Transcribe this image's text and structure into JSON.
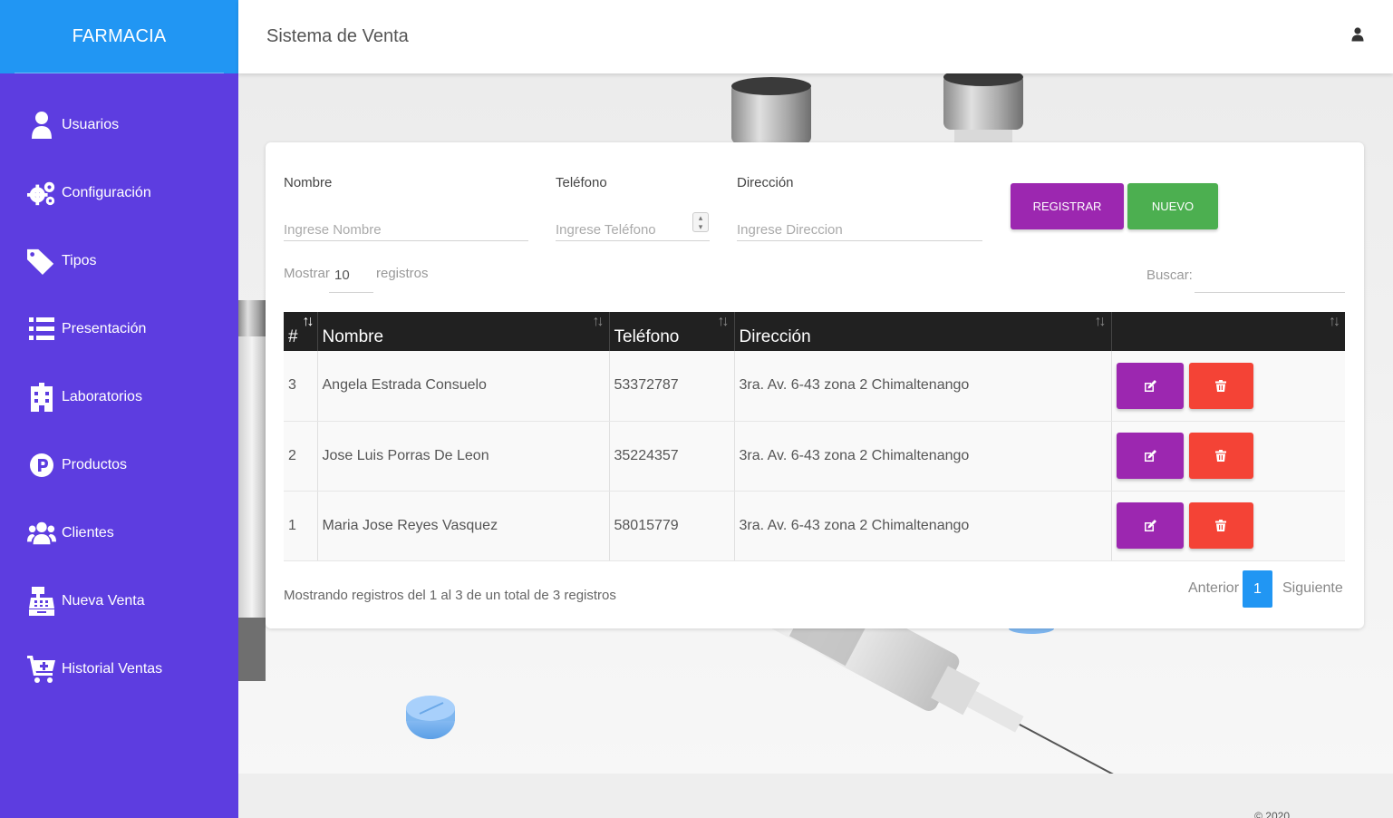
{
  "sidebar": {
    "brand": "FARMACIA",
    "items": [
      {
        "label": "Usuarios",
        "icon": "user-icon"
      },
      {
        "label": "Configuración",
        "icon": "gears-icon"
      },
      {
        "label": "Tipos",
        "icon": "tags-icon"
      },
      {
        "label": "Presentación",
        "icon": "list-icon"
      },
      {
        "label": "Laboratorios",
        "icon": "building-icon"
      },
      {
        "label": "Productos",
        "icon": "parking-icon"
      },
      {
        "label": "Clientes",
        "icon": "users-icon"
      },
      {
        "label": "Nueva Venta",
        "icon": "cash-register-icon"
      },
      {
        "label": "Historial Ventas",
        "icon": "cart-plus-icon"
      }
    ]
  },
  "header": {
    "title": "Sistema de Venta"
  },
  "form": {
    "nombre": {
      "label": "Nombre",
      "placeholder": "Ingrese Nombre"
    },
    "telefono": {
      "label": "Teléfono",
      "placeholder": "Ingrese Teléfono"
    },
    "direccion": {
      "label": "Dirección",
      "placeholder": "Ingrese Direccion"
    },
    "register_label": "Registrar",
    "new_label": "Nuevo"
  },
  "table_controls": {
    "show_label": "Mostrar",
    "show_value": "10",
    "records_label": "registros",
    "search_label": "Buscar:"
  },
  "table": {
    "headers": [
      "#",
      "Nombre",
      "Teléfono",
      "Dirección",
      ""
    ],
    "rows": [
      {
        "id": "3",
        "nombre": "Angela Estrada Consuelo",
        "telefono": "53372787",
        "direccion": "3ra. Av. 6-43 zona 2 Chimaltenango"
      },
      {
        "id": "2",
        "nombre": "Jose Luis Porras De Leon",
        "telefono": "35224357",
        "direccion": "3ra. Av. 6-43 zona 2 Chimaltenango"
      },
      {
        "id": "1",
        "nombre": "Maria Jose Reyes Vasquez",
        "telefono": "58015779",
        "direccion": "3ra. Av. 6-43 zona 2 Chimaltenango"
      }
    ]
  },
  "footer_info": "Mostrando registros del 1 al 3 de un total de 3 registros",
  "pagination": {
    "prev": "Anterior",
    "current": "1",
    "next": "Siguiente"
  },
  "copyright": "© 2020",
  "colors": {
    "sidebar": "#5d3de0",
    "brand": "#2196f3",
    "purple": "#9c27b0",
    "green": "#4caf50",
    "red": "#f44336",
    "table_header": "#212121"
  }
}
